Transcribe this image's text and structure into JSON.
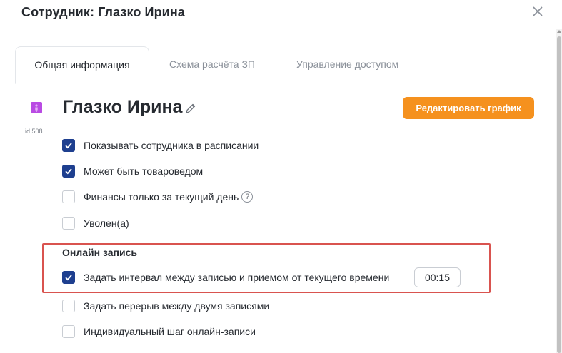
{
  "dialog": {
    "title": "Сотрудник: Глазко Ирина"
  },
  "tabs": [
    {
      "label": "Общая информация",
      "active": true
    },
    {
      "label": "Схема расчёта ЗП",
      "active": false
    },
    {
      "label": "Управление доступом",
      "active": false
    }
  ],
  "employee": {
    "name": "Глазко Ирина",
    "id_label": "id 508",
    "avatar_color": "#b94be3",
    "edit_schedule_label": "Редактировать график"
  },
  "options": [
    {
      "label": "Показывать сотрудника в расписании",
      "checked": true
    },
    {
      "label": "Может быть товароведом",
      "checked": true
    },
    {
      "label": "Финансы только за текущий день",
      "checked": false,
      "help": "?"
    },
    {
      "label": "Уволен(а)",
      "checked": false
    }
  ],
  "online_booking": {
    "title": "Онлайн запись",
    "items": [
      {
        "label": "Задать интервал между записью и приемом от текущего времени",
        "checked": true,
        "value": "00:15"
      },
      {
        "label": "Задать перерыв между двумя записями",
        "checked": false
      },
      {
        "label": "Индивидуальный шаг онлайн-записи",
        "checked": false
      }
    ]
  },
  "colors": {
    "accent": "#f5911e",
    "checkbox_checked": "#1e3f8f",
    "highlight": "#d9534f"
  }
}
